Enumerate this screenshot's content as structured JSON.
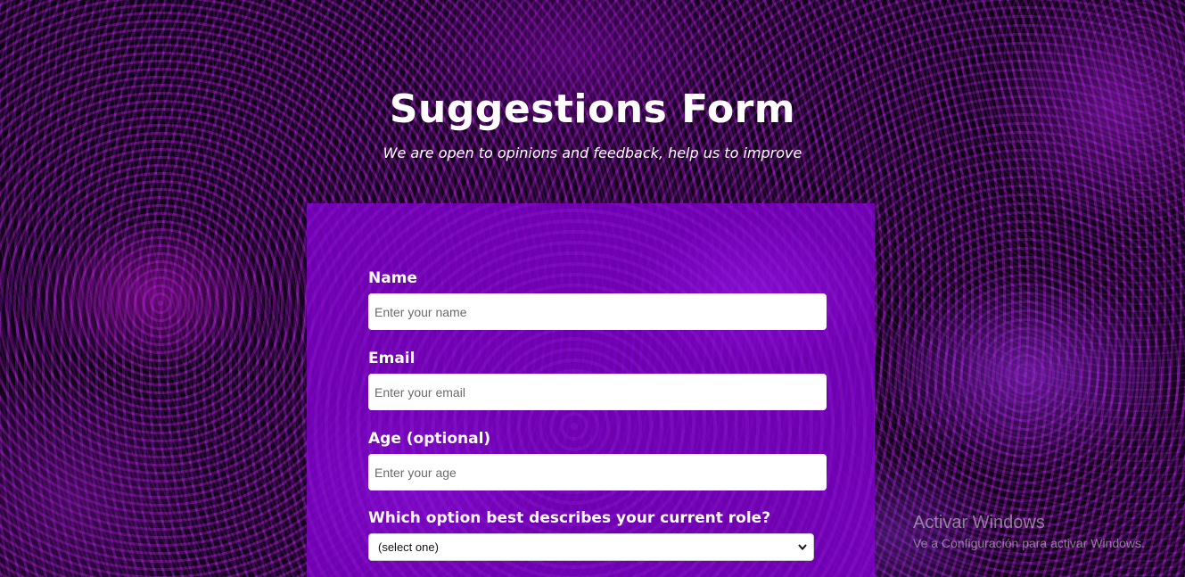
{
  "header": {
    "title": "Suggestions Form",
    "subtitle": "We are open to opinions and feedback, help us to improve"
  },
  "form": {
    "name": {
      "label": "Name",
      "placeholder": "Enter your name",
      "value": ""
    },
    "email": {
      "label": "Email",
      "placeholder": "Enter your email",
      "value": ""
    },
    "age": {
      "label": "Age (optional)",
      "placeholder": "Enter your age",
      "value": ""
    },
    "role": {
      "label": "Which option best describes your current role?",
      "selected": "(select one)"
    }
  },
  "watermark": {
    "title": "Activar Windows",
    "subtitle": "Ve a Configuración para activar Windows."
  },
  "colors": {
    "card": "#7d00c8",
    "background": "#14001c",
    "text": "#ffffff"
  }
}
